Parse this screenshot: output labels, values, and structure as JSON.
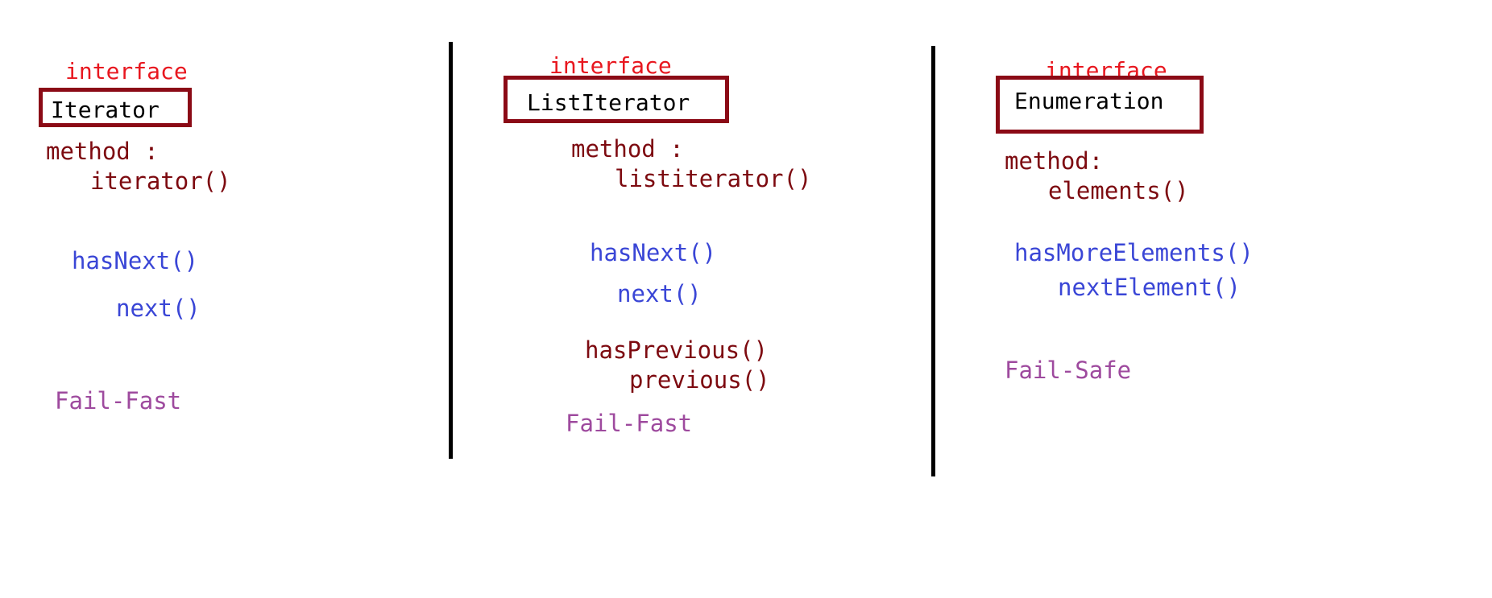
{
  "columns": [
    {
      "keyword": "interface",
      "name": "Iterator",
      "method_label": "method :",
      "method_call": "iterator()",
      "methods": [
        "hasNext()",
        "next()"
      ],
      "behavior": "Fail-Fast"
    },
    {
      "keyword": "interface",
      "name": "ListIterator",
      "method_label": "method :",
      "method_call": "listiterator()",
      "methods": [
        "hasNext()",
        "next()"
      ],
      "extra_methods": [
        "hasPrevious()",
        "previous()"
      ],
      "behavior": "Fail-Fast"
    },
    {
      "keyword": "interface",
      "name": "Enumeration",
      "method_label": "method:",
      "method_call": "elements()",
      "methods": [
        "hasMoreElements()",
        "nextElement()"
      ],
      "behavior": "Fail-Safe"
    }
  ],
  "colors": {
    "keyword": "#e8171f",
    "box_border": "#8b0a16",
    "method_call": "#7d0a10",
    "core_methods": "#3a46d6",
    "behavior": "#9e4a9e",
    "divider": "#000000"
  }
}
